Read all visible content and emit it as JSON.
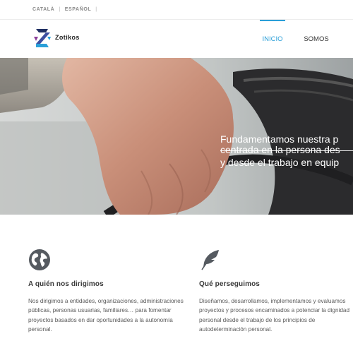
{
  "languages": {
    "items": [
      "CATALÀ",
      "ESPAÑOL"
    ],
    "separator": "|"
  },
  "header": {
    "brand": "Zotikos",
    "nav": [
      {
        "label": "INICIO",
        "active": true
      },
      {
        "label": "SOMOS",
        "active": false
      }
    ],
    "accent_color": "#2a9fd8"
  },
  "hero": {
    "lines": [
      "Fundamentamos nuestra p",
      "centrada en la persona des",
      "y desde el trabajo en equip"
    ]
  },
  "sections": [
    {
      "icon": "globe-icon",
      "title": "A quién nos dirigimos",
      "text": "Nos dirigimos a entidades, organizaciones, administraciones públicas, personas usuarias, familiares… para fomentar proyectos basados en dar oportunidades a la autonomía personal."
    },
    {
      "icon": "feather-icon",
      "title": "Qué perseguimos",
      "text": "Diseñamos, desarrollamos, implementamos y evaluamos proyectos y procesos encaminados a potenciar la dignidad personal desde el trabajo de los principios de autodeterminación personal."
    }
  ]
}
